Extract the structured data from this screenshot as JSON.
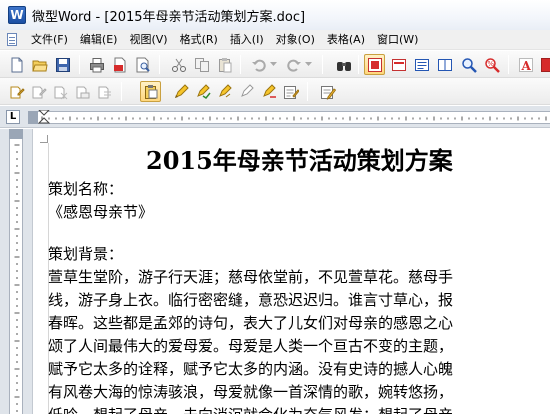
{
  "window": {
    "title": "微型Word - [2015年母亲节活动策划方案.doc]",
    "app_icon_letter": "W"
  },
  "menu": {
    "items": [
      {
        "label": "文件(F)"
      },
      {
        "label": "编辑(E)"
      },
      {
        "label": "视图(V)"
      },
      {
        "label": "格式(R)"
      },
      {
        "label": "插入(I)"
      },
      {
        "label": "对象(O)"
      },
      {
        "label": "表格(A)"
      },
      {
        "label": "窗口(W)"
      }
    ]
  },
  "ruler": {
    "corner_glyph": "L"
  },
  "document": {
    "title": "2015年母亲节活动策划方案",
    "lines": [
      "策划名称：",
      "《感恩母亲节》",
      "",
      "策划背景：",
      "萱草生堂阶，游子行天涯；慈母依堂前，不见萱草花。慈母手",
      "线，游子身上衣。临行密密缝，意恐迟迟归。谁言寸草心，报",
      "春晖。这些都是孟郊的诗句，表大了儿女们对母亲的感恩之心",
      "颂了人间最伟大的爱母爱。母爱是人类一个亘古不变的主题，",
      "赋予它太多的诠释，赋予它太多的内涵。没有史诗的撼人心魄",
      "有风卷大海的惊涛骇浪，母爱就像一首深情的歌，婉转悠扬，",
      "低吟，想起了母亲，未向消沉就会化为奋气风发；想起了母亲"
    ]
  },
  "colors": {
    "accent_red": "#d62b2b",
    "accent_blue": "#2456b3",
    "pressed_bg": "#ffd77d"
  }
}
